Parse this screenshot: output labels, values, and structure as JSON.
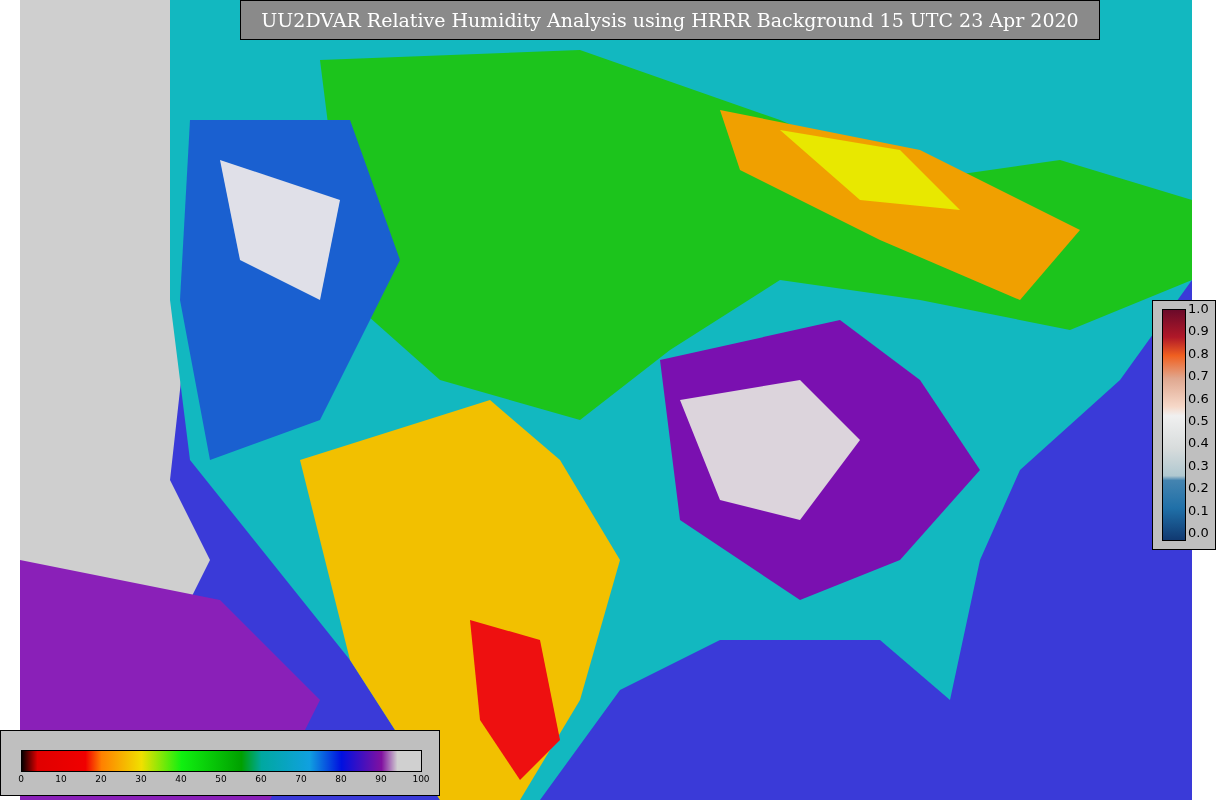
{
  "title": "UU2DVAR Relative Humidity Analysis using HRRR Background 15 UTC 23 Apr 2020",
  "side_colorbar": {
    "ticks": [
      "1.0",
      "0.9",
      "0.8",
      "0.7",
      "0.6",
      "0.5",
      "0.4",
      "0.3",
      "0.2",
      "0.1",
      "0.0"
    ]
  },
  "bottom_colorbar": {
    "ticks": [
      "0",
      "10",
      "20",
      "30",
      "40",
      "50",
      "60",
      "70",
      "80",
      "90",
      "100"
    ]
  }
}
